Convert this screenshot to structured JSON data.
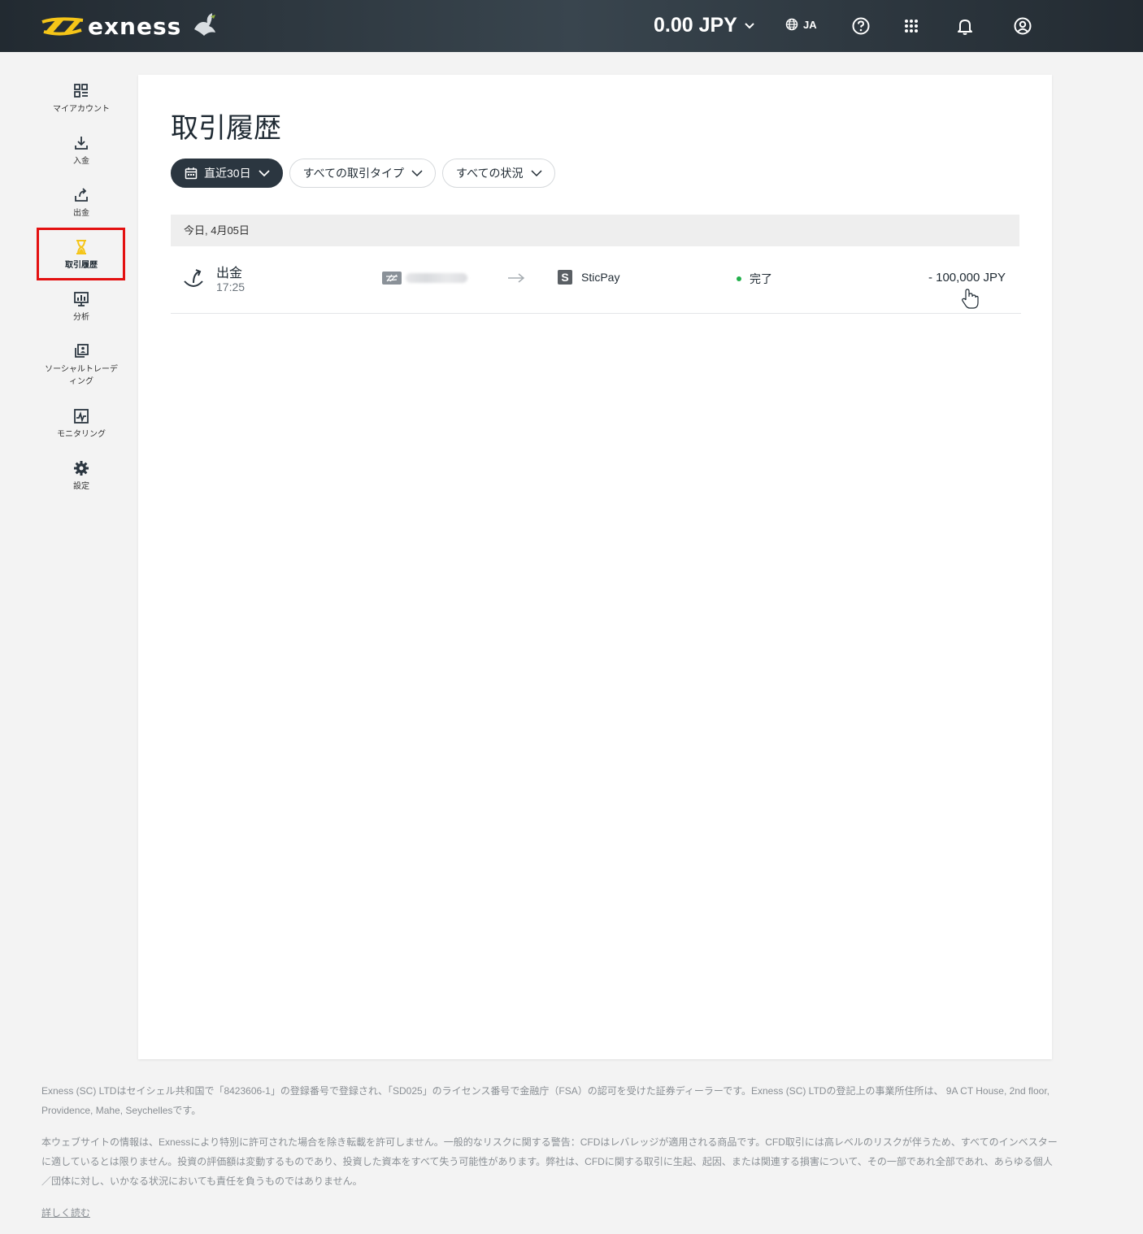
{
  "header": {
    "brand": "exness",
    "balance": "0.00 JPY",
    "language": "JA",
    "icons": [
      "help-icon",
      "apps-grid-icon",
      "bell-icon",
      "account-icon"
    ]
  },
  "sidebar": {
    "items": [
      {
        "label": "マイアカウント",
        "icon": "dashboard-icon"
      },
      {
        "label": "入金",
        "icon": "deposit-icon"
      },
      {
        "label": "出金",
        "icon": "withdraw-icon"
      },
      {
        "label": "取引履歴",
        "icon": "hourglass-icon",
        "active": true
      },
      {
        "label": "分析",
        "icon": "analytics-icon"
      },
      {
        "label": "ソーシャルトレーデ",
        "label_line2": "ィング",
        "icon": "social-trading-icon"
      },
      {
        "label": "モニタリング",
        "icon": "monitoring-icon"
      },
      {
        "label": "設定",
        "icon": "gear-icon"
      }
    ]
  },
  "main": {
    "title": "取引履歴",
    "filters": {
      "period": "直近30日",
      "type": "すべての取引タイプ",
      "status": "すべての状況"
    },
    "date_header": "今日, 4月05日",
    "transactions": [
      {
        "type": "出金",
        "time": "17:25",
        "destination": "SticPay",
        "status": "完了",
        "amount": "- 100,000 JPY"
      }
    ]
  },
  "colors": {
    "accent_yellow": "#f5c518",
    "header_dark": "#2b3640",
    "status_green": "#22b04b",
    "highlight_red": "#e31010"
  },
  "footer": {
    "p1": "Exness (SC) LTDはセイシェル共和国で「8423606-1」の登録番号で登録され、「SD025」のライセンス番号で金融庁（FSA）の認可を受けた証券ディーラーです。Exness (SC) LTDの登記上の事業所住所は、 9A CT House, 2nd floor, Providence, Mahe, Seychellesです。",
    "p2": "本ウェブサイトの情報は、Exnessにより特別に許可された場合を除き転載を許可しません。一般的なリスクに関する警告：CFDはレバレッジが適用される商品です。CFD取引には高レベルのリスクが伴うため、すべてのインベスターに適しているとは限りません。投資の評価額は変動するものであり、投資した資本をすべて失う可能性があります。弊社は、CFDに関する取引に生起、起因、または関連する損害について、その一部であれ全部であれ、あらゆる個人／団体に対し、いかなる状況においても責任を負うものではありません。",
    "read_more": "詳しく読む"
  }
}
